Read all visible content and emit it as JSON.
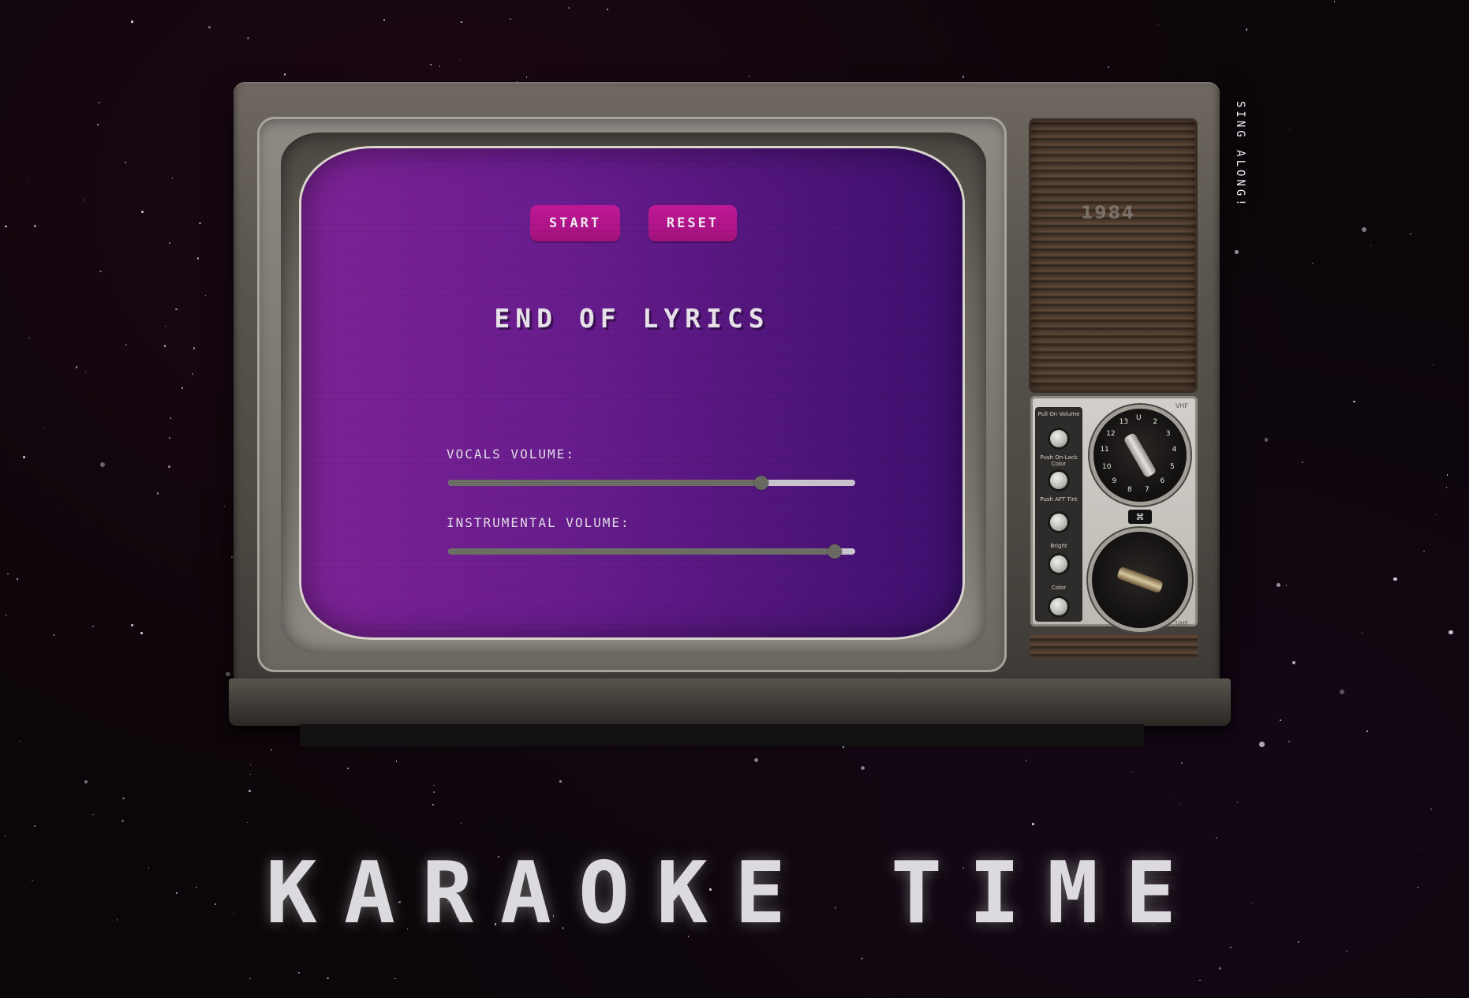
{
  "page": {
    "title": "KARAOKE TIME",
    "side_text": "SING ALONG!"
  },
  "screen": {
    "start_label": "START",
    "reset_label": "RESET",
    "lyrics_text": "END OF LYRICS",
    "vocals_label": "VOCALS VOLUME:",
    "instrumental_label": "INSTRUMENTAL VOLUME:",
    "vocals_volume": 0.77,
    "instrumental_volume": 0.95
  },
  "tv_controls": {
    "labels": [
      "Pull On Volume",
      "Push On-Lock Color",
      "Push AFT Tint",
      "Bright",
      "Color"
    ],
    "vhf_label": "VHF",
    "uhf_label": "UHF",
    "fine_tune_symbol": "⌘",
    "vhf_numbers": [
      "U",
      "2",
      "3",
      "4",
      "5",
      "6",
      "7",
      "8",
      "9",
      "10",
      "11",
      "12",
      "13"
    ],
    "speaker_logo": "1984"
  },
  "colors": {
    "screen_gradient_start": "#7e2398",
    "screen_gradient_end": "#3e1070",
    "button": "#b8168d",
    "text": "#ece6ee",
    "background": "#0b0609"
  }
}
